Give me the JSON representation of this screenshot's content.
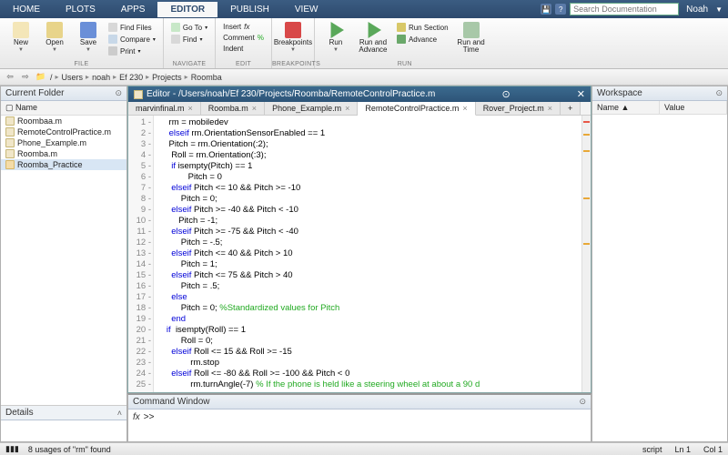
{
  "tabs": {
    "items": [
      "HOME",
      "PLOTS",
      "APPS",
      "EDITOR",
      "PUBLISH",
      "VIEW"
    ],
    "active": "EDITOR"
  },
  "search_placeholder": "Search Documentation",
  "user": "Noah",
  "ribbon": {
    "file": {
      "label": "FILE",
      "new": "New",
      "open": "Open",
      "save": "Save",
      "findfiles": "Find Files",
      "compare": "Compare",
      "print": "Print"
    },
    "nav": {
      "label": "NAVIGATE",
      "goto": "Go To",
      "find": "Find"
    },
    "edit": {
      "label": "EDIT",
      "insert": "Insert",
      "comment": "Comment",
      "indent": "Indent",
      "fx": "fx"
    },
    "bp": {
      "label": "BREAKPOINTS",
      "breakpoints": "Breakpoints"
    },
    "run": {
      "label": "RUN",
      "run": "Run",
      "runadv": "Run and\nAdvance",
      "runsec": "Run Section",
      "advance": "Advance",
      "runtime": "Run and\nTime"
    }
  },
  "breadcrumbs": [
    "/",
    "Users",
    "noah",
    "Ef 230",
    "Projects",
    "Roomba"
  ],
  "current_folder": {
    "title": "Current Folder",
    "col": "Name",
    "items": [
      {
        "name": "Roombaa.m",
        "type": "file"
      },
      {
        "name": "RemoteControlPractice.m",
        "type": "file"
      },
      {
        "name": "Phone_Example.m",
        "type": "file"
      },
      {
        "name": "Roomba.m",
        "type": "file"
      },
      {
        "name": "Roomba_Practice",
        "type": "folder",
        "selected": true
      }
    ]
  },
  "details": {
    "title": "Details"
  },
  "editor": {
    "title": "Editor - /Users/noah/Ef 230/Projects/Roomba/RemoteControlPractice.m",
    "tabs": [
      {
        "label": "marvinfinal.m"
      },
      {
        "label": "Roomba.m"
      },
      {
        "label": "Phone_Example.m"
      },
      {
        "label": "RemoteControlPractice.m",
        "active": true
      },
      {
        "label": "Rover_Project.m"
      }
    ],
    "lines": [
      "    rm = mobiledev",
      "    elseif rm.OrientationSensorEnabled == 1",
      "    Pitch = rm.Orientation(:2);",
      "     Roll = rm.Orientation(:3);",
      "     if isempty(Pitch) == 1",
      "            Pitch = 0",
      "     elseif Pitch <= 10 && Pitch >= -10",
      "         Pitch = 0;",
      "     elseif Pitch >= -40 && Pitch < -10",
      "        Pitch = -1;",
      "     elseif Pitch >= -75 && Pitch < -40",
      "         Pitch = -.5;",
      "     elseif Pitch <= 40 && Pitch > 10",
      "         Pitch = 1;",
      "     elseif Pitch <= 75 && Pitch > 40",
      "         Pitch = .5;",
      "     else",
      "         Pitch = 0; %Standardized values for Pitch",
      "     end",
      "   if  isempty(Roll) == 1",
      "         Roll = 0;",
      "     elseif Roll <= 15 && Roll >= -15",
      "             rm.stop",
      "     elseif Roll <= -80 && Roll >= -100 && Pitch < 0",
      "             rm.turnAngle(-7) % If the phone is held like a steering wheel at about a 90 d"
    ]
  },
  "command_window": {
    "title": "Command Window",
    "prompt": ">>"
  },
  "workspace": {
    "title": "Workspace",
    "cols": [
      "Name ▲",
      "Value"
    ]
  },
  "status": {
    "usages": "8 usages of \"rm\" found",
    "mode": "script",
    "ln": "Ln  1",
    "col": "Col  1"
  }
}
